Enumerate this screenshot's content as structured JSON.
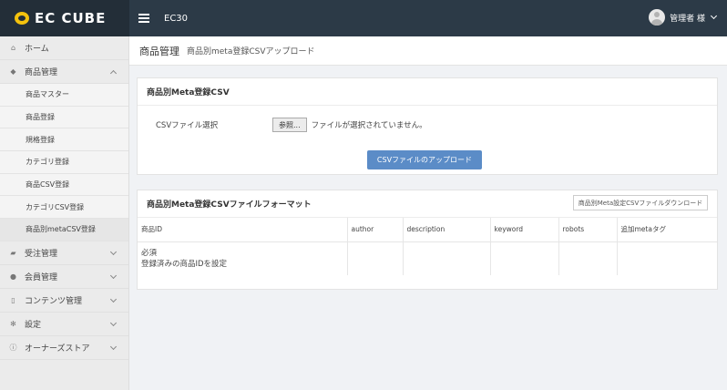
{
  "header": {
    "logo": "EC CUBE",
    "shop_name": "EC30",
    "user_name": "管理者 様"
  },
  "sidebar": {
    "items": [
      {
        "icon": "home-icon",
        "label": "ホーム"
      },
      {
        "icon": "tag-icon",
        "label": "商品管理"
      },
      {
        "icon": "cart-icon",
        "label": "受注管理"
      },
      {
        "icon": "users-icon",
        "label": "会員管理"
      },
      {
        "icon": "file-icon",
        "label": "コンテンツ管理"
      },
      {
        "icon": "gear-icon",
        "label": "設定"
      },
      {
        "icon": "info-icon",
        "label": "オーナーズストア"
      }
    ],
    "product_sub": [
      "商品マスター",
      "商品登録",
      "規格登録",
      "カテゴリ登録",
      "商品CSV登録",
      "カテゴリCSV登録",
      "商品別metaCSV登録"
    ]
  },
  "page": {
    "title": "商品管理",
    "subtitle": "商品別meta登録CSVアップロード"
  },
  "upload_panel": {
    "title": "商品別Meta登録CSV",
    "field_label": "CSVファイル選択",
    "browse_label": "参照...",
    "no_file_text": "ファイルが選択されていません。",
    "upload_label": "CSVファイルのアップロード"
  },
  "format_panel": {
    "title": "商品別Meta登録CSVファイルフォーマット",
    "download_label": "商品別Meta設定CSVファイルダウンロード",
    "columns": [
      "商品ID",
      "author",
      "description",
      "keyword",
      "robots",
      "追加metaタグ"
    ],
    "row": {
      "line1": "必須",
      "line2": "登録済みの商品IDを設定"
    }
  }
}
